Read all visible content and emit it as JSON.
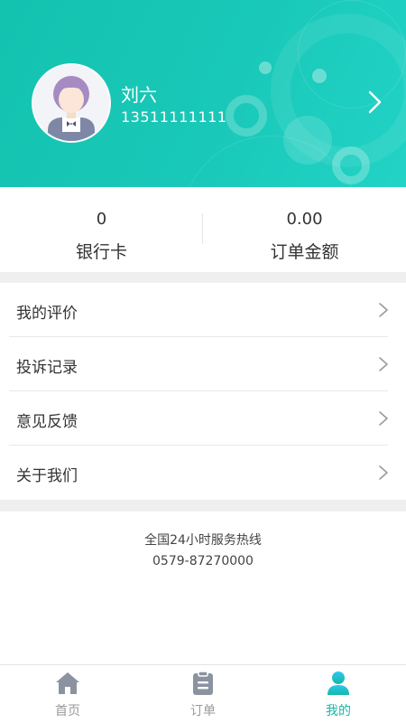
{
  "profile": {
    "name": "刘六",
    "phone": "13511111111",
    "avatar_icon": "user-avatar"
  },
  "stats": [
    {
      "value": "0",
      "label": "银行卡"
    },
    {
      "value": "0.00",
      "label": "订单金额"
    }
  ],
  "menu": [
    {
      "label": "我的评价"
    },
    {
      "label": "投诉记录"
    },
    {
      "label": "意见反馈"
    },
    {
      "label": "关于我们"
    }
  ],
  "hotline": {
    "title": "全国24小时服务热线",
    "number": "0579-87270000"
  },
  "tabs": [
    {
      "label": "首页",
      "icon": "home-icon",
      "active": false
    },
    {
      "label": "订单",
      "icon": "order-icon",
      "active": false
    },
    {
      "label": "我的",
      "icon": "user-icon",
      "active": true
    }
  ],
  "colors": {
    "header": "#19c8b8",
    "accent": "#14b8a6",
    "inactive_tab": "#8c93a0"
  }
}
